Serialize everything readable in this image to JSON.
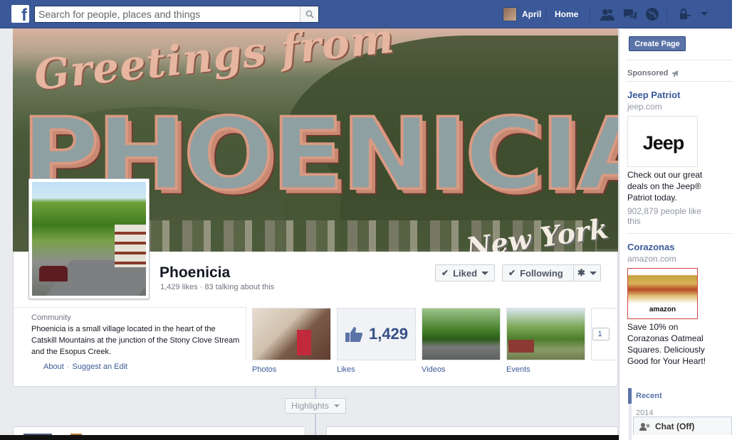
{
  "topbar": {
    "logo": "f",
    "search_placeholder": "Search for people, places and things",
    "user_name": "April",
    "home_label": "Home",
    "icons": [
      "friend-requests-icon",
      "messages-icon",
      "notifications-icon",
      "privacy-shortcuts-icon",
      "account-menu-icon"
    ]
  },
  "cover": {
    "greeting": "Greetings from",
    "title": "PHOENICIA",
    "subtitle": "New York"
  },
  "page": {
    "name": "Phoenicia",
    "stats": "1,429 likes · 83 talking about this",
    "liked_label": "Liked",
    "following_label": "Following"
  },
  "about": {
    "category": "Community",
    "description": "Phoenicia is a small village located in the heart of the Catskill Mountains at the junction of the Stony Clove Stream and the Esopus Creek.",
    "about_link": "About",
    "separator": "·",
    "suggest_link": "Suggest an Edit"
  },
  "apps": {
    "tiles": [
      {
        "label": "Photos"
      },
      {
        "label": "Likes",
        "count": "1,429"
      },
      {
        "label": "Videos"
      },
      {
        "label": "Events"
      }
    ],
    "more_count": "1"
  },
  "timeline": {
    "highlights_label": "Highlights"
  },
  "sidebar": {
    "create_page_label": "Create Page",
    "sponsored_label": "Sponsored",
    "ads": [
      {
        "title": "Jeep Patriot",
        "domain": "jeep.com",
        "image_text": "Jeep",
        "text": "Check out our great deals on the Jeep® Patriot today.",
        "likes": "902,879 people like this"
      },
      {
        "title": "Corazonas",
        "domain": "amazon.com",
        "image_text": "amazon",
        "text": "Save 10% on Corazonas Oatmeal Squares. Deliciously Good for Your Heart!"
      }
    ],
    "recent_label": "Recent",
    "year_label": "2014",
    "chat_label": "Chat (Off)"
  },
  "colors": {
    "brand_blue": "#3b5998",
    "link_blue": "#3b5998",
    "button_blue": "#5b74a8",
    "page_bg": "#e9ebee"
  }
}
